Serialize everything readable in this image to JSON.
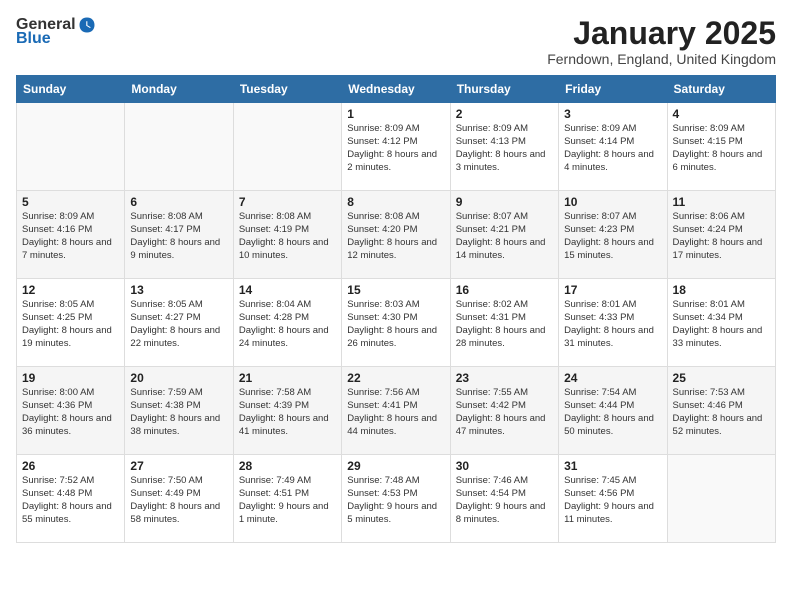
{
  "logo": {
    "general": "General",
    "blue": "Blue"
  },
  "title": "January 2025",
  "location": "Ferndown, England, United Kingdom",
  "days_of_week": [
    "Sunday",
    "Monday",
    "Tuesday",
    "Wednesday",
    "Thursday",
    "Friday",
    "Saturday"
  ],
  "weeks": [
    [
      {
        "day": "",
        "sunrise": "",
        "sunset": "",
        "daylight": ""
      },
      {
        "day": "",
        "sunrise": "",
        "sunset": "",
        "daylight": ""
      },
      {
        "day": "",
        "sunrise": "",
        "sunset": "",
        "daylight": ""
      },
      {
        "day": "1",
        "sunrise": "Sunrise: 8:09 AM",
        "sunset": "Sunset: 4:12 PM",
        "daylight": "Daylight: 8 hours and 2 minutes."
      },
      {
        "day": "2",
        "sunrise": "Sunrise: 8:09 AM",
        "sunset": "Sunset: 4:13 PM",
        "daylight": "Daylight: 8 hours and 3 minutes."
      },
      {
        "day": "3",
        "sunrise": "Sunrise: 8:09 AM",
        "sunset": "Sunset: 4:14 PM",
        "daylight": "Daylight: 8 hours and 4 minutes."
      },
      {
        "day": "4",
        "sunrise": "Sunrise: 8:09 AM",
        "sunset": "Sunset: 4:15 PM",
        "daylight": "Daylight: 8 hours and 6 minutes."
      }
    ],
    [
      {
        "day": "5",
        "sunrise": "Sunrise: 8:09 AM",
        "sunset": "Sunset: 4:16 PM",
        "daylight": "Daylight: 8 hours and 7 minutes."
      },
      {
        "day": "6",
        "sunrise": "Sunrise: 8:08 AM",
        "sunset": "Sunset: 4:17 PM",
        "daylight": "Daylight: 8 hours and 9 minutes."
      },
      {
        "day": "7",
        "sunrise": "Sunrise: 8:08 AM",
        "sunset": "Sunset: 4:19 PM",
        "daylight": "Daylight: 8 hours and 10 minutes."
      },
      {
        "day": "8",
        "sunrise": "Sunrise: 8:08 AM",
        "sunset": "Sunset: 4:20 PM",
        "daylight": "Daylight: 8 hours and 12 minutes."
      },
      {
        "day": "9",
        "sunrise": "Sunrise: 8:07 AM",
        "sunset": "Sunset: 4:21 PM",
        "daylight": "Daylight: 8 hours and 14 minutes."
      },
      {
        "day": "10",
        "sunrise": "Sunrise: 8:07 AM",
        "sunset": "Sunset: 4:23 PM",
        "daylight": "Daylight: 8 hours and 15 minutes."
      },
      {
        "day": "11",
        "sunrise": "Sunrise: 8:06 AM",
        "sunset": "Sunset: 4:24 PM",
        "daylight": "Daylight: 8 hours and 17 minutes."
      }
    ],
    [
      {
        "day": "12",
        "sunrise": "Sunrise: 8:05 AM",
        "sunset": "Sunset: 4:25 PM",
        "daylight": "Daylight: 8 hours and 19 minutes."
      },
      {
        "day": "13",
        "sunrise": "Sunrise: 8:05 AM",
        "sunset": "Sunset: 4:27 PM",
        "daylight": "Daylight: 8 hours and 22 minutes."
      },
      {
        "day": "14",
        "sunrise": "Sunrise: 8:04 AM",
        "sunset": "Sunset: 4:28 PM",
        "daylight": "Daylight: 8 hours and 24 minutes."
      },
      {
        "day": "15",
        "sunrise": "Sunrise: 8:03 AM",
        "sunset": "Sunset: 4:30 PM",
        "daylight": "Daylight: 8 hours and 26 minutes."
      },
      {
        "day": "16",
        "sunrise": "Sunrise: 8:02 AM",
        "sunset": "Sunset: 4:31 PM",
        "daylight": "Daylight: 8 hours and 28 minutes."
      },
      {
        "day": "17",
        "sunrise": "Sunrise: 8:01 AM",
        "sunset": "Sunset: 4:33 PM",
        "daylight": "Daylight: 8 hours and 31 minutes."
      },
      {
        "day": "18",
        "sunrise": "Sunrise: 8:01 AM",
        "sunset": "Sunset: 4:34 PM",
        "daylight": "Daylight: 8 hours and 33 minutes."
      }
    ],
    [
      {
        "day": "19",
        "sunrise": "Sunrise: 8:00 AM",
        "sunset": "Sunset: 4:36 PM",
        "daylight": "Daylight: 8 hours and 36 minutes."
      },
      {
        "day": "20",
        "sunrise": "Sunrise: 7:59 AM",
        "sunset": "Sunset: 4:38 PM",
        "daylight": "Daylight: 8 hours and 38 minutes."
      },
      {
        "day": "21",
        "sunrise": "Sunrise: 7:58 AM",
        "sunset": "Sunset: 4:39 PM",
        "daylight": "Daylight: 8 hours and 41 minutes."
      },
      {
        "day": "22",
        "sunrise": "Sunrise: 7:56 AM",
        "sunset": "Sunset: 4:41 PM",
        "daylight": "Daylight: 8 hours and 44 minutes."
      },
      {
        "day": "23",
        "sunrise": "Sunrise: 7:55 AM",
        "sunset": "Sunset: 4:42 PM",
        "daylight": "Daylight: 8 hours and 47 minutes."
      },
      {
        "day": "24",
        "sunrise": "Sunrise: 7:54 AM",
        "sunset": "Sunset: 4:44 PM",
        "daylight": "Daylight: 8 hours and 50 minutes."
      },
      {
        "day": "25",
        "sunrise": "Sunrise: 7:53 AM",
        "sunset": "Sunset: 4:46 PM",
        "daylight": "Daylight: 8 hours and 52 minutes."
      }
    ],
    [
      {
        "day": "26",
        "sunrise": "Sunrise: 7:52 AM",
        "sunset": "Sunset: 4:48 PM",
        "daylight": "Daylight: 8 hours and 55 minutes."
      },
      {
        "day": "27",
        "sunrise": "Sunrise: 7:50 AM",
        "sunset": "Sunset: 4:49 PM",
        "daylight": "Daylight: 8 hours and 58 minutes."
      },
      {
        "day": "28",
        "sunrise": "Sunrise: 7:49 AM",
        "sunset": "Sunset: 4:51 PM",
        "daylight": "Daylight: 9 hours and 1 minute."
      },
      {
        "day": "29",
        "sunrise": "Sunrise: 7:48 AM",
        "sunset": "Sunset: 4:53 PM",
        "daylight": "Daylight: 9 hours and 5 minutes."
      },
      {
        "day": "30",
        "sunrise": "Sunrise: 7:46 AM",
        "sunset": "Sunset: 4:54 PM",
        "daylight": "Daylight: 9 hours and 8 minutes."
      },
      {
        "day": "31",
        "sunrise": "Sunrise: 7:45 AM",
        "sunset": "Sunset: 4:56 PM",
        "daylight": "Daylight: 9 hours and 11 minutes."
      },
      {
        "day": "",
        "sunrise": "",
        "sunset": "",
        "daylight": ""
      }
    ]
  ]
}
